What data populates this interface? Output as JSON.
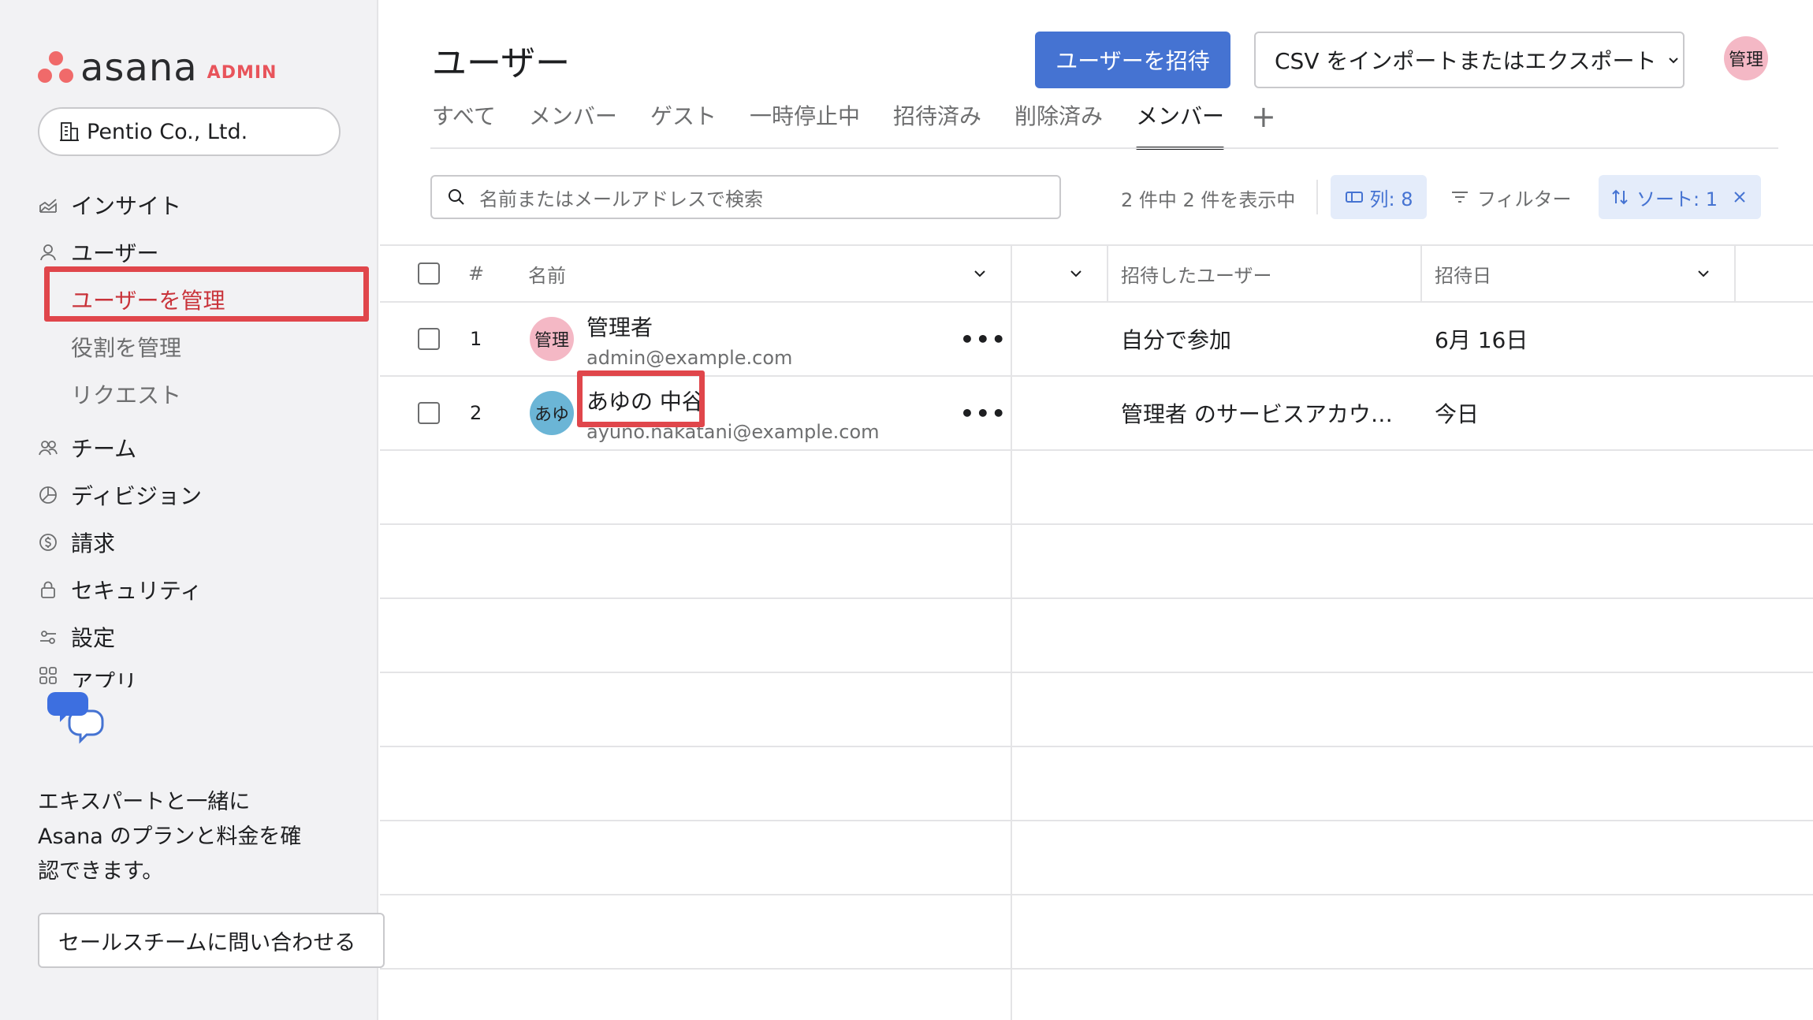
{
  "app": {
    "brand": "asana",
    "brand_badge": "ADMIN",
    "org_name": "Pentio Co., Ltd."
  },
  "sidebar": {
    "items": [
      {
        "label": "インサイト",
        "icon": "insights-icon"
      },
      {
        "label": "ユーザー",
        "icon": "user-icon"
      },
      {
        "label": "チーム",
        "icon": "team-icon"
      },
      {
        "label": "ディビジョン",
        "icon": "division-icon"
      },
      {
        "label": "請求",
        "icon": "billing-icon"
      },
      {
        "label": "セキュリティ",
        "icon": "lock-icon"
      },
      {
        "label": "設定",
        "icon": "settings-icon"
      },
      {
        "label": "アプリ",
        "icon": "apps-icon"
      }
    ],
    "user_subitems": [
      {
        "label": "ユーザーを管理",
        "active": true
      },
      {
        "label": "役割を管理"
      },
      {
        "label": "リクエスト"
      }
    ],
    "promo_lines": [
      "エキスパートと一緒に",
      "Asana のプランと料金を確",
      "認できます。"
    ],
    "sales_button": "セールスチームに問い合わせる"
  },
  "header": {
    "title": "ユーザー",
    "invite_button": "ユーザーを招待",
    "csv_button": "CSV をインポートまたはエクスポート",
    "avatar": "管理"
  },
  "tabs": [
    {
      "label": "すべて"
    },
    {
      "label": "メンバー"
    },
    {
      "label": "ゲスト"
    },
    {
      "label": "一時停止中"
    },
    {
      "label": "招待済み"
    },
    {
      "label": "削除済み"
    },
    {
      "label": "メンバー",
      "active": true
    }
  ],
  "toolbar": {
    "search_placeholder": "名前またはメールアドレスで検索",
    "count_text": "2 件中 2 件を表示中",
    "columns_chip": "列: 8",
    "filter_label": "フィルター",
    "sort_chip": "ソート: 1"
  },
  "table": {
    "headers": {
      "number": "#",
      "name": "名前",
      "invited_by": "招待したユーザー",
      "invite_date": "招待日"
    },
    "rows": [
      {
        "num": "1",
        "avatar": "管理",
        "name": "管理者",
        "email": "admin@example.com",
        "invited_by": "自分で参加",
        "invite_date": "6月 16日"
      },
      {
        "num": "2",
        "avatar": "あゆ",
        "name": "あゆの 中谷",
        "email": "ayuno.nakatani@example.com",
        "invited_by": "管理者 のサービスアカウ…",
        "invite_date": "今日"
      }
    ]
  },
  "colors": {
    "accent": "#4573d2",
    "highlight": "#e0464b",
    "brand": "#f06a6a"
  }
}
